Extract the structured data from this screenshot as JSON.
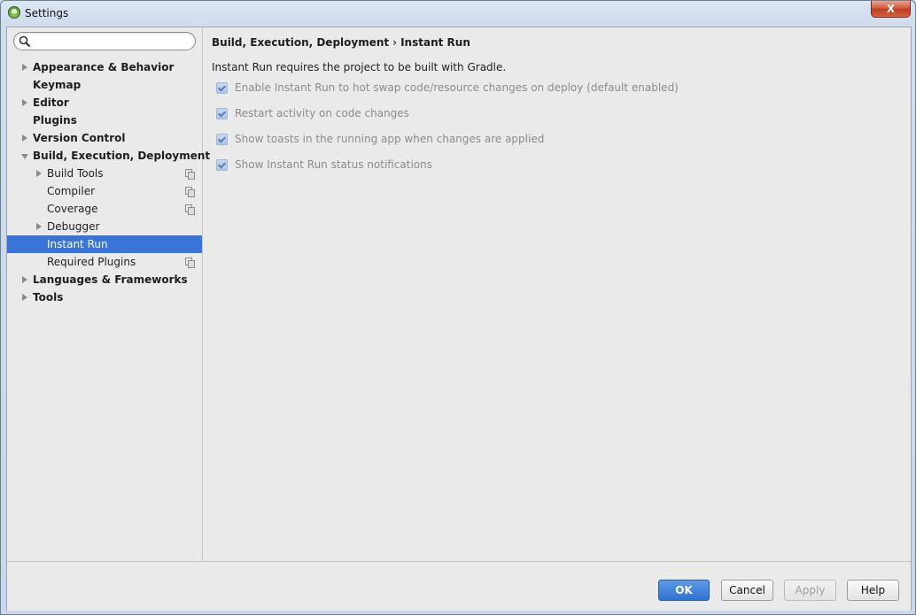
{
  "window": {
    "title": "Settings",
    "close_label": "X"
  },
  "search": {
    "value": "",
    "placeholder": ""
  },
  "sidebar": {
    "items": [
      {
        "label": "Appearance & Behavior",
        "level": 0,
        "expander": "collapsed",
        "project_icon": false,
        "selected": false
      },
      {
        "label": "Keymap",
        "level": 0,
        "expander": "none",
        "project_icon": false,
        "selected": false
      },
      {
        "label": "Editor",
        "level": 0,
        "expander": "collapsed",
        "project_icon": false,
        "selected": false
      },
      {
        "label": "Plugins",
        "level": 0,
        "expander": "none",
        "project_icon": false,
        "selected": false
      },
      {
        "label": "Version Control",
        "level": 0,
        "expander": "collapsed",
        "project_icon": false,
        "selected": false
      },
      {
        "label": "Build, Execution, Deployment",
        "level": 0,
        "expander": "expanded",
        "project_icon": false,
        "selected": false
      },
      {
        "label": "Build Tools",
        "level": 1,
        "expander": "collapsed",
        "project_icon": true,
        "selected": false
      },
      {
        "label": "Compiler",
        "level": 1,
        "expander": "none",
        "project_icon": true,
        "selected": false
      },
      {
        "label": "Coverage",
        "level": 1,
        "expander": "none",
        "project_icon": true,
        "selected": false
      },
      {
        "label": "Debugger",
        "level": 1,
        "expander": "collapsed",
        "project_icon": false,
        "selected": false
      },
      {
        "label": "Instant Run",
        "level": 1,
        "expander": "none",
        "project_icon": false,
        "selected": true
      },
      {
        "label": "Required Plugins",
        "level": 1,
        "expander": "none",
        "project_icon": true,
        "selected": false
      },
      {
        "label": "Languages & Frameworks",
        "level": 0,
        "expander": "collapsed",
        "project_icon": false,
        "selected": false
      },
      {
        "label": "Tools",
        "level": 0,
        "expander": "collapsed",
        "project_icon": false,
        "selected": false
      }
    ]
  },
  "main": {
    "breadcrumb": {
      "parent": "Build, Execution, Deployment",
      "separator": "›",
      "current": "Instant Run"
    },
    "info_text": "Instant Run requires the project to be built with Gradle.",
    "options": [
      {
        "label": "Enable Instant Run to hot swap code/resource changes on deploy (default enabled)",
        "checked": true,
        "enabled": false
      },
      {
        "label": "Restart activity on code changes",
        "checked": true,
        "enabled": false
      },
      {
        "label": "Show toasts in the running app when changes are applied",
        "checked": true,
        "enabled": false
      },
      {
        "label": "Show Instant Run status notifications",
        "checked": true,
        "enabled": false
      }
    ]
  },
  "footer": {
    "ok_label": "OK",
    "cancel_label": "Cancel",
    "apply_label": "Apply",
    "help_label": "Help"
  },
  "colors": {
    "selection": "#3875d6",
    "primary_button": "#3271d2",
    "close_button": "#c13c1d",
    "disabled_text": "#8c8c8c"
  }
}
